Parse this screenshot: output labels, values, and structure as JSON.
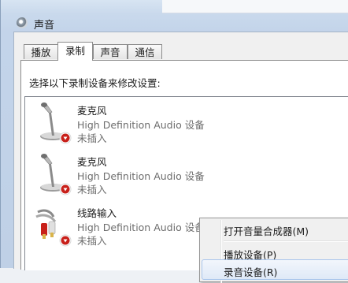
{
  "window": {
    "title": "声音"
  },
  "tabs": [
    {
      "label": "播放",
      "active": false
    },
    {
      "label": "录制",
      "active": true
    },
    {
      "label": "声音",
      "active": false
    },
    {
      "label": "通信",
      "active": false
    }
  ],
  "panel": {
    "prompt": "选择以下录制设备来修改设置:"
  },
  "devices": [
    {
      "name": "麦克风",
      "driver": "High Definition Audio 设备",
      "status": "未插入",
      "icon": "microphone-icon"
    },
    {
      "name": "麦克风",
      "driver": "High Definition Audio 设备",
      "status": "未插入",
      "icon": "microphone-icon"
    },
    {
      "name": "线路输入",
      "driver": "High Definition Audio 设备",
      "status": "未插入",
      "icon": "line-in-cable-icon"
    }
  ],
  "context_menu": {
    "items": [
      {
        "label": "打开音量合成器(M)"
      },
      {
        "label": "播放设备(P)"
      },
      {
        "label": "录音设备(R)"
      }
    ]
  },
  "colors": {
    "status_badge": "#c8201a",
    "menu_highlight": "#dfe9f7"
  }
}
